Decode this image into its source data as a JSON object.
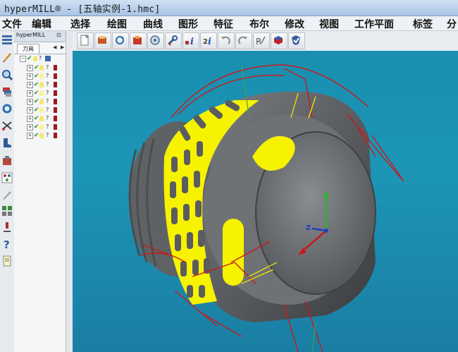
{
  "window": {
    "title": "hyperMILL® - [五轴实例-1.hmc]"
  },
  "menu": {
    "items": [
      "文件",
      "编辑",
      "选择",
      "绘图",
      "曲线",
      "图形",
      "特征",
      "布尔",
      "修改",
      "视图",
      "工作平面",
      "标签",
      "分"
    ]
  },
  "panel": {
    "title": "hyperMILL",
    "tab_label": "刀具",
    "tree_rows": 9
  },
  "toolbar": {
    "buttons": [
      "new-doc-icon",
      "open-icon",
      "rotate-icon",
      "save-icon",
      "target-icon",
      "wrench-icon",
      "info-icon",
      "info-2-icon",
      "undo-icon",
      "redo-icon",
      "reference-icon",
      "box-3d-icon",
      "shield-icon"
    ]
  },
  "left_tools": {
    "icons": [
      "list-icon",
      "pencil-icon",
      "magnify-icon",
      "layers-icon",
      "refresh-icon",
      "scissors-icon",
      "boot-icon",
      "hand-icon",
      "palette-icon",
      "warning-icon",
      "grid-icon",
      "tool-icon",
      "help-icon",
      "note-icon"
    ]
  },
  "colors": {
    "viewport_bg": "#1a8fb0",
    "part_gray": "#6f7275",
    "toolpath_yellow": "#f6f200",
    "toolpath_red": "#c81a1a"
  },
  "axis": {
    "z_label": "Z"
  }
}
